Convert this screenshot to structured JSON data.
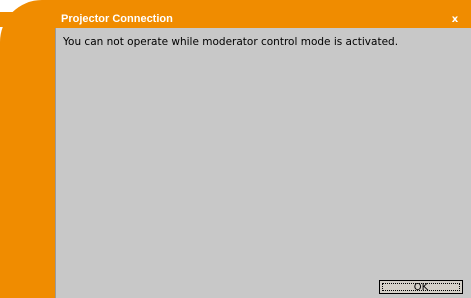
{
  "window": {
    "title": "Projector Connection",
    "close_glyph": "x"
  },
  "dialog": {
    "message": "You can not operate while moderator control mode is activated.",
    "ok_label": "OK"
  },
  "colors": {
    "accent": "#f08c00",
    "panel": "#c8c8c8",
    "title_text": "#ffffff"
  }
}
